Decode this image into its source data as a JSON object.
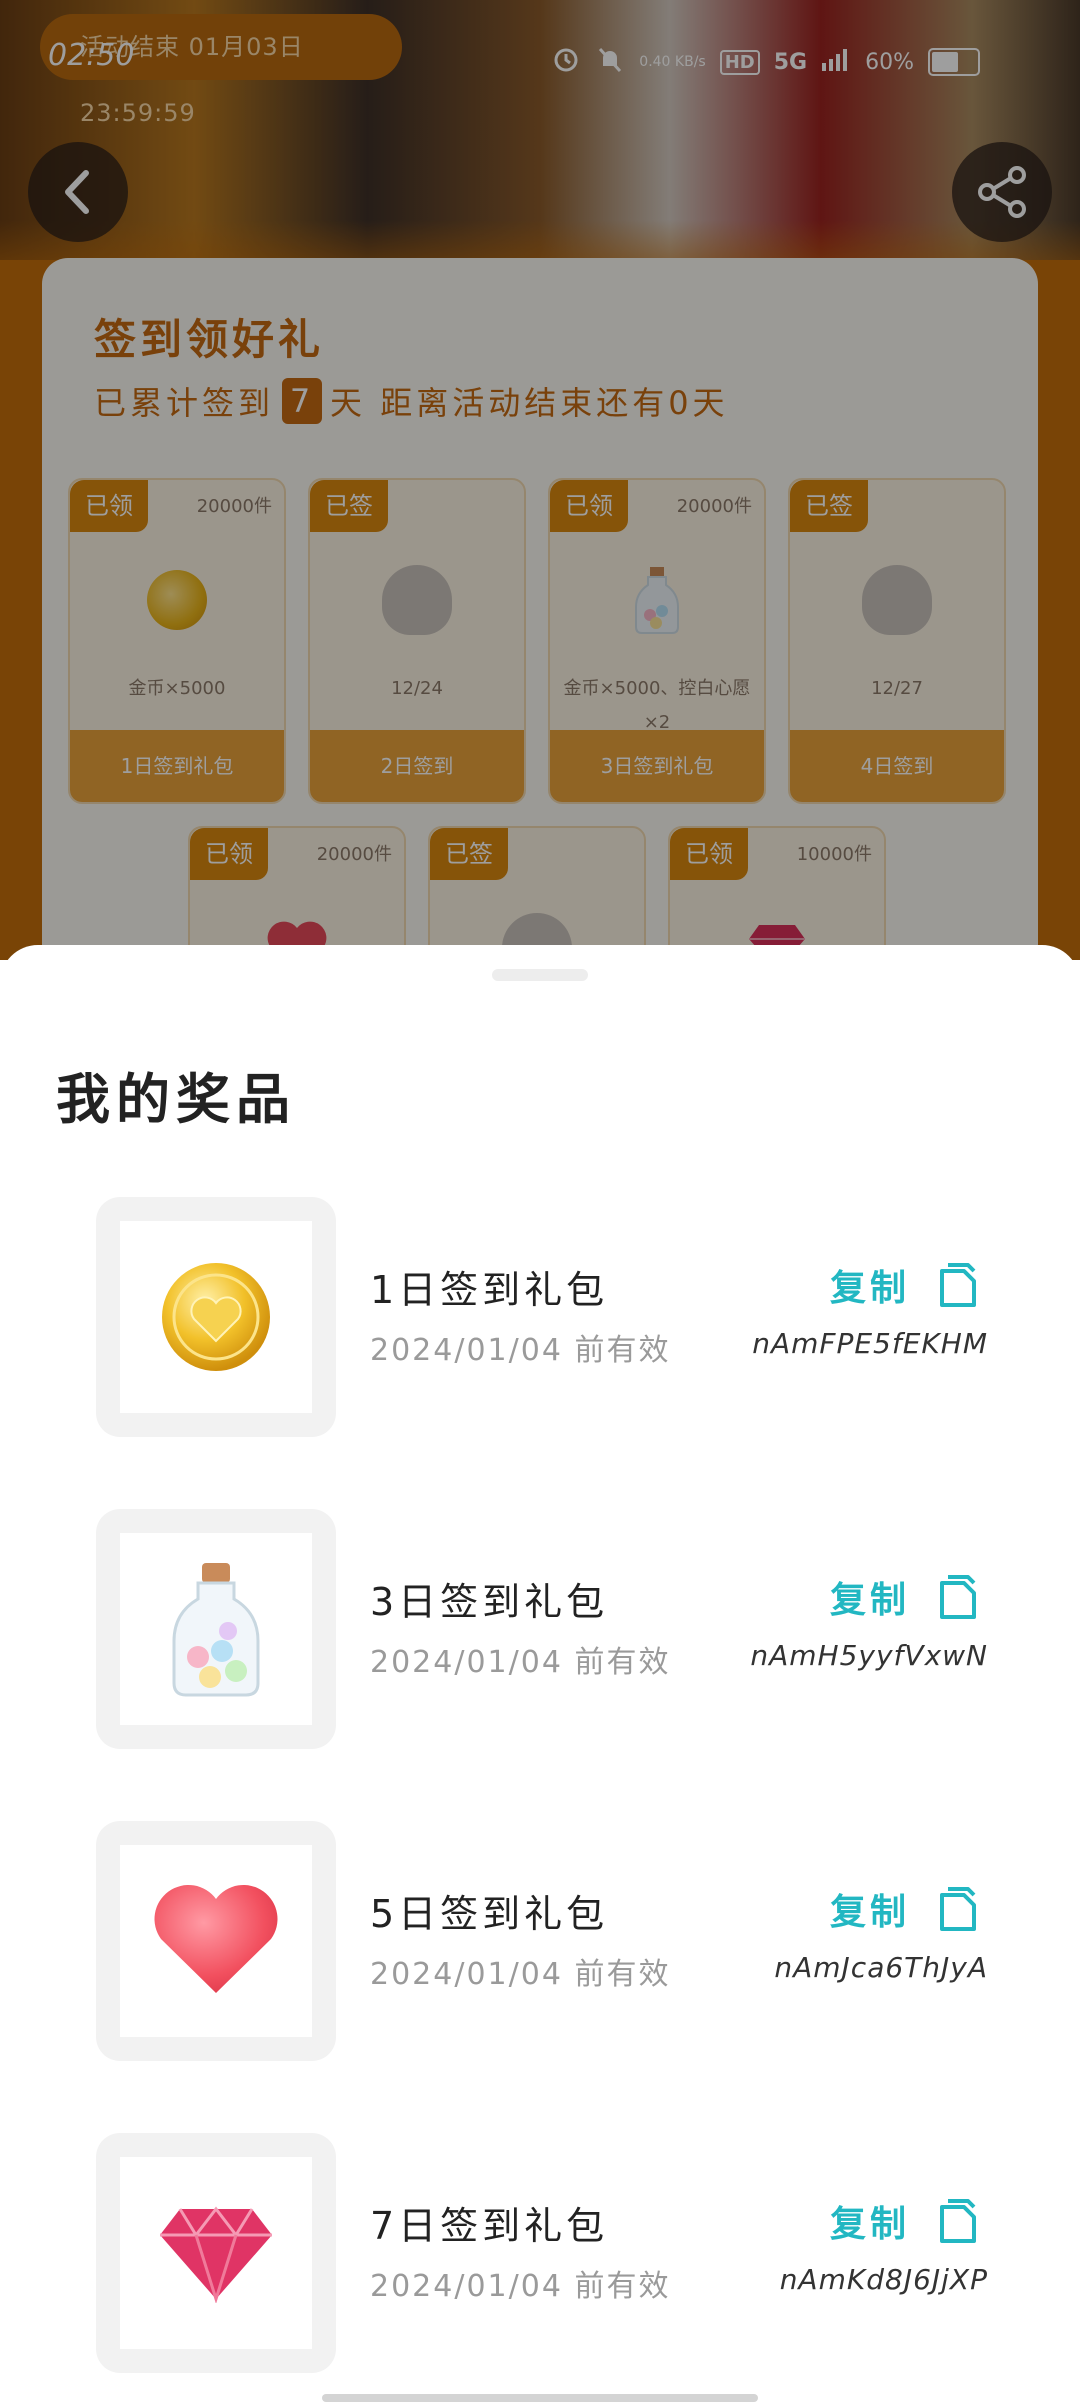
{
  "status_bar": {
    "time": "02:50",
    "net_speed": "0.40 KB/s",
    "hd": "HD",
    "network": "5G",
    "battery": "60%"
  },
  "banner": {
    "activity_countdown": "活动结束 01月03日 23:59:59"
  },
  "signin": {
    "title": "签到领好礼",
    "sub_prefix": "已累计签到",
    "days": "7",
    "sub_suffix": "天  距离活动结束还有0天",
    "rewards": [
      {
        "tag": "已领",
        "stock": "20000件",
        "desc": "金币×5000",
        "footer": "1日签到礼包"
      },
      {
        "tag": "已签",
        "stock": "",
        "desc": "12/24",
        "footer": "2日签到"
      },
      {
        "tag": "已领",
        "stock": "20000件",
        "desc": "金币×5000、控白心愿×2",
        "footer": "3日签到礼包"
      },
      {
        "tag": "已签",
        "stock": "",
        "desc": "12/27",
        "footer": "4日签到"
      },
      {
        "tag": "已领",
        "stock": "20000件",
        "desc": "",
        "footer": ""
      },
      {
        "tag": "已签",
        "stock": "",
        "desc": "",
        "footer": ""
      },
      {
        "tag": "已领",
        "stock": "10000件",
        "desc": "",
        "footer": ""
      }
    ]
  },
  "sheet": {
    "title": "我的奖品",
    "prizes": [
      {
        "name": "1日签到礼包",
        "valid": "2024/01/04 前有效",
        "copy_label": "复制",
        "code": "nAmFPE5fEKHM",
        "icon": "gold-coin-heart"
      },
      {
        "name": "3日签到礼包",
        "valid": "2024/01/04 前有效",
        "copy_label": "复制",
        "code": "nAmH5yyfVxwN",
        "icon": "wish-bottle"
      },
      {
        "name": "5日签到礼包",
        "valid": "2024/01/04 前有效",
        "copy_label": "复制",
        "code": "nAmJca6ThJyA",
        "icon": "pink-heart"
      },
      {
        "name": "7日签到礼包",
        "valid": "2024/01/04 前有效",
        "copy_label": "复制",
        "code": "nAmKd8J6JjXP",
        "icon": "pink-diamond"
      }
    ]
  },
  "colors": {
    "accent": "#22b7c2",
    "orange": "#c46e0a"
  }
}
